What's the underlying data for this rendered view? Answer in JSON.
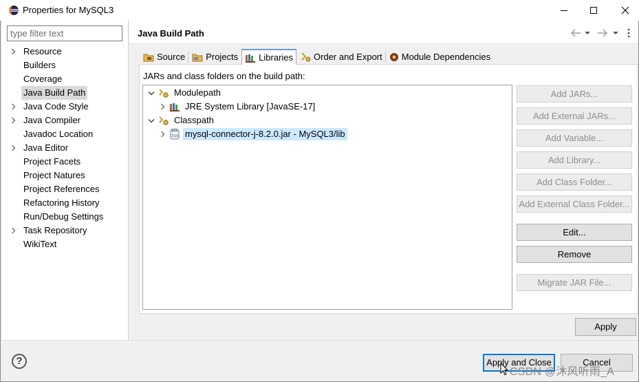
{
  "window": {
    "title": "Properties for MySQL3",
    "controls": {
      "minimize": "—",
      "maximize": "☐",
      "close": "✕"
    }
  },
  "sidebar": {
    "filter_placeholder": "type filter text",
    "items": [
      {
        "label": "Resource",
        "expandable": true
      },
      {
        "label": "Builders",
        "expandable": false
      },
      {
        "label": "Coverage",
        "expandable": false
      },
      {
        "label": "Java Build Path",
        "expandable": false,
        "selected": true
      },
      {
        "label": "Java Code Style",
        "expandable": true
      },
      {
        "label": "Java Compiler",
        "expandable": true
      },
      {
        "label": "Javadoc Location",
        "expandable": false
      },
      {
        "label": "Java Editor",
        "expandable": true
      },
      {
        "label": "Project Facets",
        "expandable": false
      },
      {
        "label": "Project Natures",
        "expandable": false
      },
      {
        "label": "Project References",
        "expandable": false
      },
      {
        "label": "Refactoring History",
        "expandable": false
      },
      {
        "label": "Run/Debug Settings",
        "expandable": false
      },
      {
        "label": "Task Repository",
        "expandable": true
      },
      {
        "label": "WikiText",
        "expandable": false
      }
    ]
  },
  "main": {
    "title": "Java Build Path",
    "tabs": [
      {
        "label": "Source",
        "icon": "source-folder-icon"
      },
      {
        "label": "Projects",
        "icon": "projects-icon"
      },
      {
        "label": "Libraries",
        "icon": "libraries-icon",
        "active": true
      },
      {
        "label": "Order and Export",
        "icon": "order-export-icon"
      },
      {
        "label": "Module Dependencies",
        "icon": "module-dependencies-icon"
      }
    ],
    "panel_label": "JARs and class folders on the build path:",
    "tree": [
      {
        "label": "Modulepath",
        "expanded": true,
        "level": 0,
        "icon": "modulepath-icon"
      },
      {
        "label": "JRE System Library [JavaSE-17]",
        "expanded": false,
        "level": 1,
        "icon": "library-icon"
      },
      {
        "label": "Classpath",
        "expanded": true,
        "level": 0,
        "icon": "classpath-icon"
      },
      {
        "label": "mysql-connector-j-8.2.0.jar - MySQL3/lib",
        "expanded": false,
        "level": 1,
        "icon": "jar-icon",
        "selected": true
      }
    ],
    "buttons": [
      {
        "label": "Add JARs...",
        "enabled": false
      },
      {
        "label": "Add External JARs...",
        "enabled": false
      },
      {
        "label": "Add Variable...",
        "enabled": false
      },
      {
        "label": "Add Library...",
        "enabled": false
      },
      {
        "label": "Add Class Folder...",
        "enabled": false
      },
      {
        "label": "Add External Class Folder...",
        "enabled": false
      },
      {
        "label": "Edit...",
        "enabled": true
      },
      {
        "label": "Remove",
        "enabled": true
      },
      {
        "label": "Migrate JAR File...",
        "enabled": false
      }
    ],
    "apply_label": "Apply"
  },
  "footer": {
    "help_glyph": "?",
    "apply_close_label": "Apply and Close",
    "cancel_label": "Cancel"
  },
  "watermark": "CSDN @沐风听雨_A",
  "colors": {
    "selection": "#cce8ff",
    "focus": "#0078d7",
    "active_tab_top": "#6e9bd6"
  }
}
